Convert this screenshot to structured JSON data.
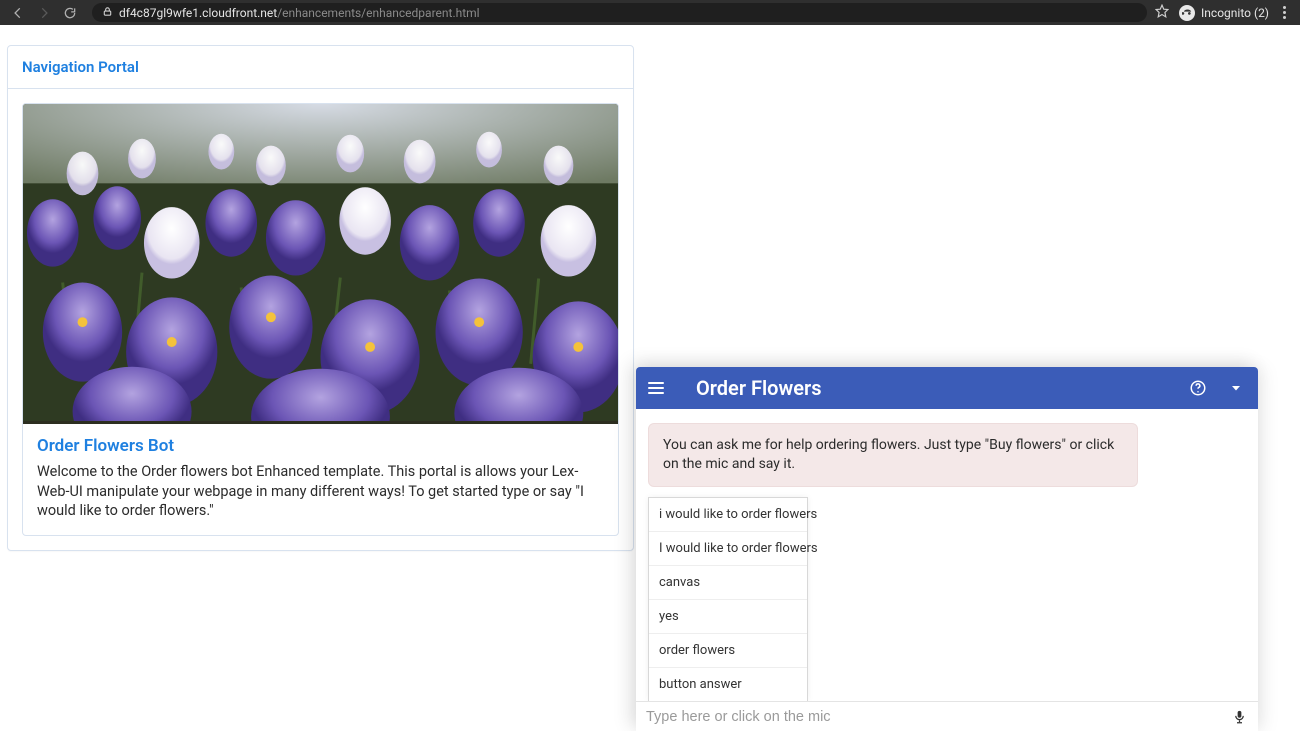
{
  "address_bar": {
    "url_host": "df4c87gl9wfe1.cloudfront.net",
    "url_path": "/enhancements/enhancedparent.html",
    "incognito_label": "Incognito (2)"
  },
  "card": {
    "header": "Navigation Portal",
    "inner_title": "Order Flowers Bot",
    "inner_desc": "Welcome to the Order flowers bot Enhanced template. This portal is allows your Lex-Web-UI manipulate your webpage in many different ways! To get started type or say \"I would like to order flowers.\""
  },
  "chat": {
    "title": "Order Flowers",
    "bot_message": "You can ask me for help ordering flowers. Just type \"Buy flowers\" or click on the mic and say it.",
    "input_placeholder": "Type here or click on the mic",
    "suggestions": [
      "i would like to order flowers",
      "I would like to order flowers",
      "canvas",
      "yes",
      "order flowers",
      "button answer"
    ]
  }
}
